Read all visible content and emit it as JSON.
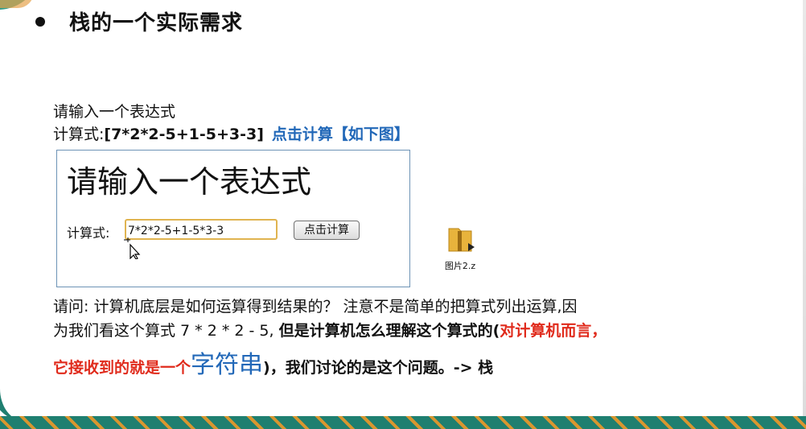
{
  "slide": {
    "title": "栈的一个实际需求",
    "intro_line1": "请输入一个表达式",
    "intro_prefix": "计算式:",
    "intro_expression": "[7*2*2-5+1-5+3-3]",
    "intro_link": "点击计算【如下图】"
  },
  "demo": {
    "heading": "请输入一个表达式",
    "label": "计算式:",
    "input_value": "7*2*2-5+1-5*3-3",
    "button_label": "点击计算"
  },
  "file": {
    "label": "图片2.z"
  },
  "question": {
    "line1": "请问: 计算机底层是如何运算得到结果的？ 注意不是简单的把算式列出运算,因",
    "line2_normal": "为我们看这个算式 7 * 2 * 2 - 5, ",
    "line2_bold": "但是计算机怎么理解这个算式的(",
    "line2_red": "对计算机而言，",
    "line3_red": "它接收到的就是一个",
    "line3_blue": "字符串",
    "line3_bold": ")，我们讨论的是这个问题。-> 栈"
  },
  "colors": {
    "link_blue": "#2268b8",
    "emphasis_red": "#e02b1c",
    "input_border": "#e0b450"
  }
}
